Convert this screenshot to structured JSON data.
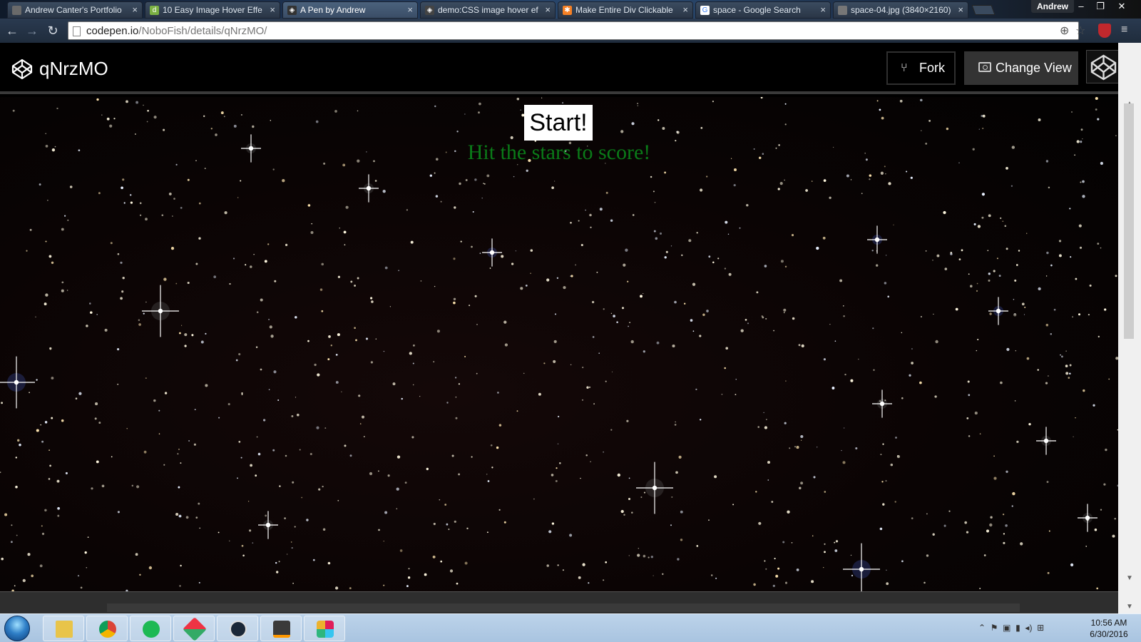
{
  "browser": {
    "tabs": [
      {
        "title": "Andrew Canter's Portfolio",
        "fav_color": "#6a6a6a",
        "fav_glyph": ""
      },
      {
        "title": "10 Easy Image Hover Effe",
        "fav_color": "#7bb043",
        "fav_glyph": "d"
      },
      {
        "title": "A Pen by Andrew",
        "fav_color": "#333333",
        "fav_glyph": "◈"
      },
      {
        "title": "demo:CSS image hover ef",
        "fav_color": "#444444",
        "fav_glyph": "◈"
      },
      {
        "title": "Make Entire Div Clickable",
        "fav_color": "#f58025",
        "fav_glyph": "✱"
      },
      {
        "title": "space - Google Search",
        "fav_color": "#ffffff",
        "fav_glyph": "G"
      },
      {
        "title": "space-04.jpg (3840×2160)",
        "fav_color": "#777777",
        "fav_glyph": ""
      }
    ],
    "active_tab_index": 2,
    "user_name": "Andrew",
    "url_host": "codepen.io",
    "url_path": "/NoboFish/details/qNrzMO/"
  },
  "codepen": {
    "pen_title": "qNrzMO",
    "fork_label": "Fork",
    "change_view_label": "Change View"
  },
  "game": {
    "start_label": "Start!",
    "hint_text": "Hit the stars to score!",
    "hint_color": "#0a7a18"
  },
  "taskbar": {
    "apps": [
      "file-explorer",
      "chrome",
      "spotify",
      "game-app",
      "steam",
      "sublime-text",
      "slack"
    ],
    "time": "10:56 AM",
    "date": "6/30/2016"
  }
}
